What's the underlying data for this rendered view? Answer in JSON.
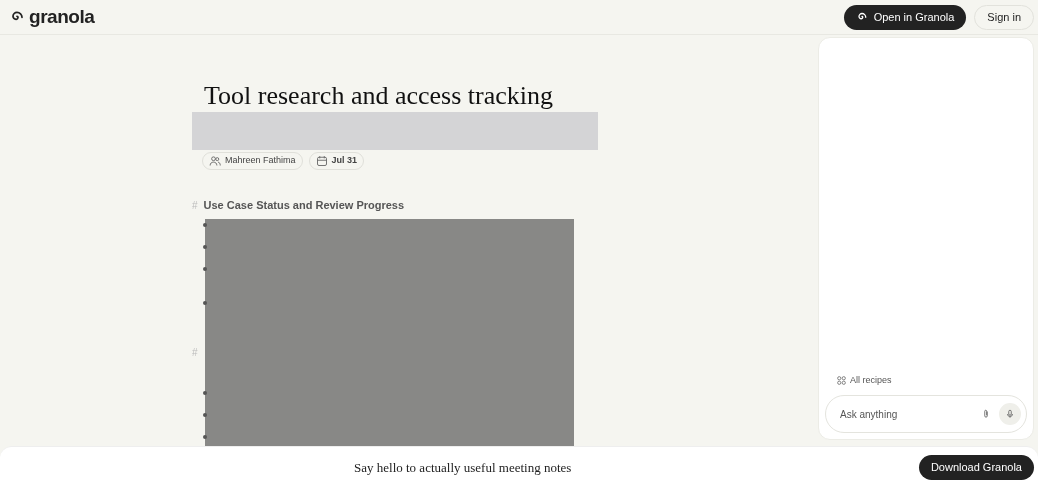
{
  "header": {
    "logo": "granola",
    "open_button": "Open in Granola",
    "sign_in": "Sign in"
  },
  "note": {
    "title": "Tool research and access tracking",
    "chips": [
      {
        "kind": "people",
        "label": "Mahreen Fathima"
      },
      {
        "kind": "date",
        "label": "Jul 31"
      }
    ],
    "sections": [
      {
        "marker": "#",
        "heading": "Use Case Status and Review Progress"
      },
      {
        "marker": "#"
      }
    ]
  },
  "chat": {
    "recipes": "All recipes",
    "placeholder": "Ask anything"
  },
  "banner": {
    "text": "Say hello to actually useful meeting notes",
    "button": "Download Granola"
  }
}
